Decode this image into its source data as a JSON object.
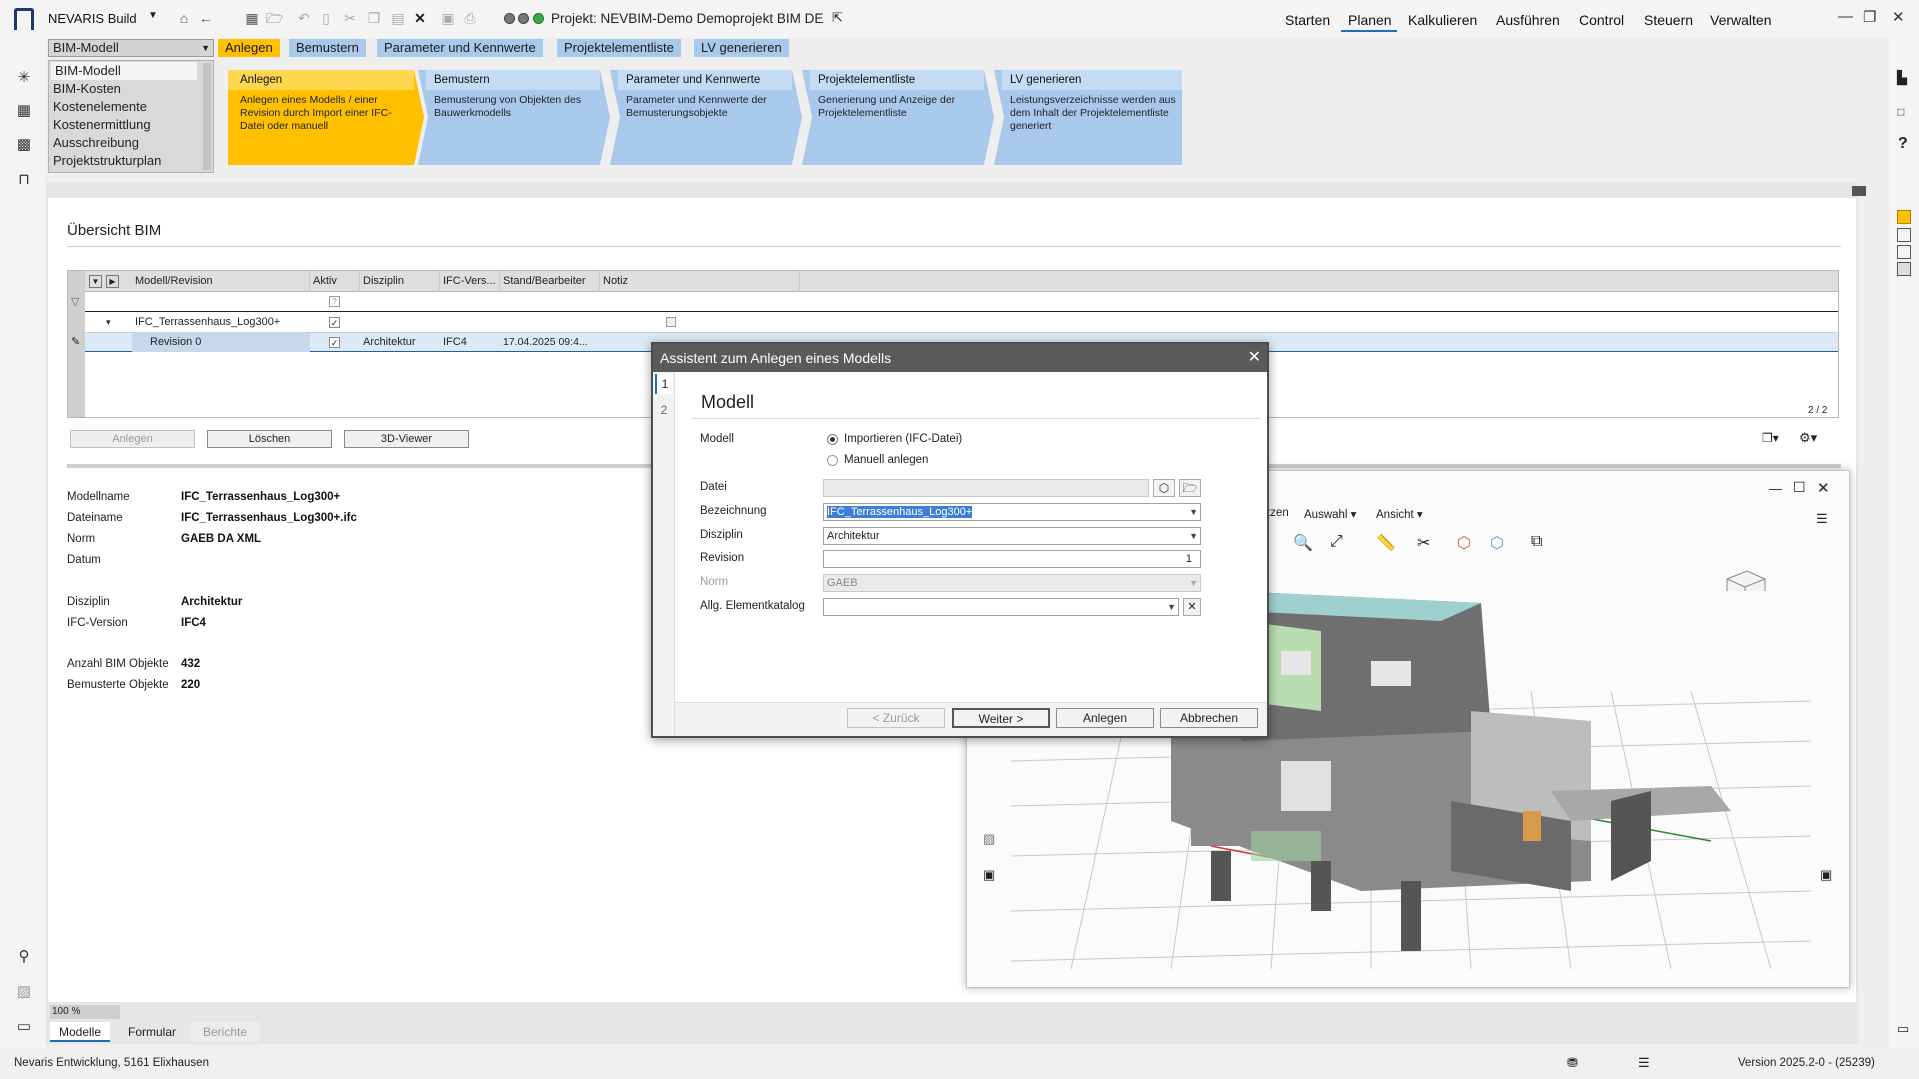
{
  "app": {
    "name": "NEVARIS Build",
    "project": "Projekt: NEVBIM-Demo Demoprojekt BIM DE"
  },
  "nav": [
    "Starten",
    "Planen",
    "Kalkulieren",
    "Ausführen",
    "Control",
    "Steuern",
    "Verwalten"
  ],
  "nav_active": "Planen",
  "bim_dropdown": "BIM-Modell",
  "bim_list": [
    "BIM-Modell",
    "BIM-Kosten",
    "Kostenelemente",
    "Kostenermittlung",
    "Ausschreibung",
    "Projektstrukturplan"
  ],
  "tabs": [
    "Anlegen",
    "Bemustern",
    "Parameter und Kennwerte",
    "Projektelementliste",
    "LV generieren"
  ],
  "steps": [
    {
      "title": "Anlegen",
      "desc": "Anlegen eines Modells / einer Revision durch Import einer IFC-Datei oder manuell"
    },
    {
      "title": "Bemustern",
      "desc": "Bemusterung von Objekten des Bauwerkmodells"
    },
    {
      "title": "Parameter und Kennwerte",
      "desc": "Parameter und Kennwerte der Bemusterungsobjekte"
    },
    {
      "title": "Projektelementliste",
      "desc": "Generierung und Anzeige der Projektelementliste"
    },
    {
      "title": "LV generieren",
      "desc": "Leistungsverzeichnisse werden aus dem Inhalt der Projektelementliste generiert"
    }
  ],
  "overview": {
    "title": "Übersicht BIM",
    "columns": [
      "Modell/Revision",
      "Aktiv",
      "Disziplin",
      "IFC-Vers...",
      "Stand/Bearbeiter",
      "Notiz"
    ],
    "model_row": "IFC_Terrassenhaus_Log300+",
    "revision_row": {
      "name": "Revision 0",
      "disziplin": "Architektur",
      "ifc": "IFC4",
      "stand": "17.04.2025 09:4..."
    },
    "pager": "2 / 2",
    "buttons": {
      "anlegen": "Anlegen",
      "loeschen": "Löschen",
      "viewer": "3D-Viewer"
    }
  },
  "details": {
    "rows": [
      {
        "label": "Modellname",
        "value": "IFC_Terrassenhaus_Log300+"
      },
      {
        "label": "Dateiname",
        "value": "IFC_Terrassenhaus_Log300+.ifc"
      },
      {
        "label": "Norm",
        "value": "GAEB DA XML"
      },
      {
        "label": "Datum",
        "value": ""
      },
      {
        "label": "Disziplin",
        "value": "Architektur"
      },
      {
        "label": "IFC-Version",
        "value": "IFC4"
      },
      {
        "label": "Anzahl BIM Objekte",
        "value": "432"
      },
      {
        "label": "Bemusterte Objekte",
        "value": "220"
      }
    ]
  },
  "viewer": {
    "menu": [
      "tzen",
      "Auswahl",
      "Ansicht"
    ]
  },
  "dialog": {
    "title": "Assistent zum Anlegen eines Modells",
    "steps": [
      "1",
      "2"
    ],
    "heading": "Modell",
    "modell_label": "Modell",
    "option_import": "Importieren (IFC-Datei)",
    "option_manual": "Manuell anlegen",
    "datei_label": "Datei",
    "datei_value": "",
    "bezeichnung_label": "Bezeichnung",
    "bezeichnung_value": "IFC_Terrassenhaus_Log300+",
    "disziplin_label": "Disziplin",
    "disziplin_value": "Architektur",
    "revision_label": "Revision",
    "revision_value": "1",
    "norm_label": "Norm",
    "norm_value": "GAEB",
    "katalog_label": "Allg. Elementkatalog",
    "katalog_value": "",
    "buttons": {
      "back": "< Zurück",
      "next": "Weiter >",
      "create": "Anlegen",
      "cancel": "Abbrechen"
    }
  },
  "zoom": "100 %",
  "bottom_tabs": [
    "Modelle",
    "Formular",
    "Berichte"
  ],
  "status": {
    "company": "Nevaris Entwicklung, 5161 Elixhausen",
    "version": "Version 2025.2-0 - (25239)"
  },
  "colors": {
    "accent": "#ffc000",
    "step_blue": "#a9c9ec",
    "nav_underline": "#1f6fbf"
  }
}
